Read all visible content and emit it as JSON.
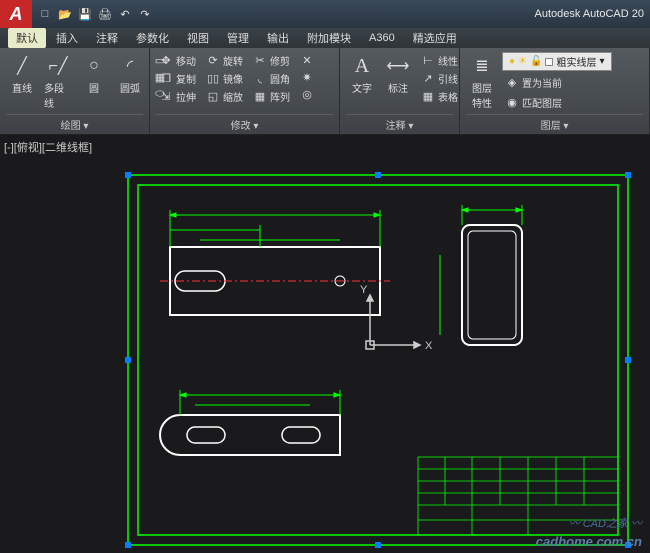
{
  "app": {
    "title": "Autodesk AutoCAD 20",
    "logo": "A"
  },
  "qat": {
    "new": "□",
    "open": "📂",
    "save": "💾",
    "undo": "↶",
    "redo": "↷",
    "print": "🖨"
  },
  "menu": {
    "items": [
      "默认",
      "插入",
      "注释",
      "参数化",
      "视图",
      "管理",
      "输出",
      "附加模块",
      "A360",
      "精选应用"
    ],
    "active": 0
  },
  "ribbon": {
    "draw": {
      "title": "绘图 ▾",
      "line": "直线",
      "polyline": "多段线",
      "circle": "圆",
      "arc": "圆弧"
    },
    "modify": {
      "title": "修改 ▾",
      "move": "移动",
      "rotate": "旋转",
      "trim": "修剪",
      "copy": "复制",
      "mirror": "镜像",
      "fillet": "圆角",
      "stretch": "拉伸",
      "scale": "缩放",
      "array": "阵列"
    },
    "annot": {
      "title": "注释 ▾",
      "text": "文字",
      "dim": "标注",
      "linear": "线性",
      "leader": "引线",
      "table": "表格"
    },
    "layer": {
      "title": "图层 ▾",
      "props": "图层\n特性",
      "make": "置为当前",
      "match": "匹配图层",
      "current": "粗实线层"
    }
  },
  "viewport": {
    "label": "[-][俯视][二维线框]",
    "x_axis": "X",
    "y_axis": "Y"
  },
  "watermark": {
    "site": "cadhome.com.cn",
    "brand": "CAD之家"
  }
}
